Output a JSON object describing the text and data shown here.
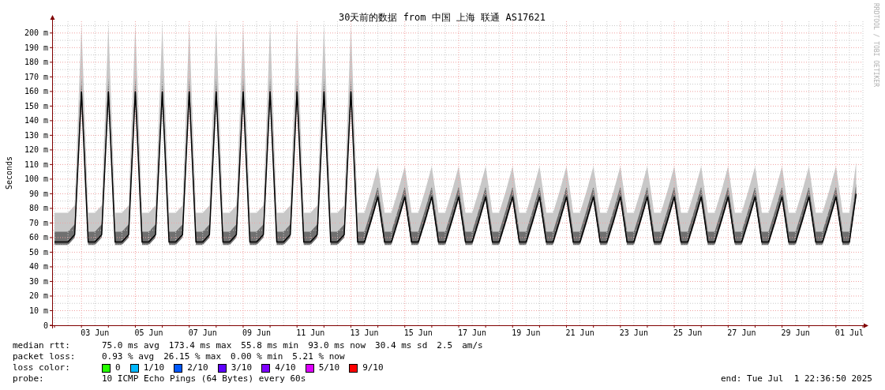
{
  "graph": {
    "credit": "RRDTOOL / TOBI OETIKER",
    "chart_data": {
      "type": "line",
      "title": "30天前的数据 from 中国 上海 联通 AS17621",
      "ylabel": "Seconds",
      "ylim": [
        0,
        208
      ],
      "grid": true,
      "yticks": [
        {
          "value": 0,
          "label": "0"
        },
        {
          "value": 10,
          "label": "10 m"
        },
        {
          "value": 20,
          "label": "20 m"
        },
        {
          "value": 30,
          "label": "30 m"
        },
        {
          "value": 40,
          "label": "40 m"
        },
        {
          "value": 50,
          "label": "50 m"
        },
        {
          "value": 60,
          "label": "60 m"
        },
        {
          "value": 70,
          "label": "70 m"
        },
        {
          "value": 80,
          "label": "80 m"
        },
        {
          "value": 90,
          "label": "90 m"
        },
        {
          "value": 100,
          "label": "100 m"
        },
        {
          "value": 110,
          "label": "110 m"
        },
        {
          "value": 120,
          "label": "120 m"
        },
        {
          "value": 130,
          "label": "130 m"
        },
        {
          "value": 140,
          "label": "140 m"
        },
        {
          "value": 150,
          "label": "150 m"
        },
        {
          "value": 160,
          "label": "160 m"
        },
        {
          "value": 170,
          "label": "170 m"
        },
        {
          "value": 180,
          "label": "180 m"
        },
        {
          "value": 190,
          "label": "190 m"
        },
        {
          "value": 200,
          "label": "200 m"
        }
      ],
      "categories": [
        null,
        null,
        null,
        null,
        null,
        null,
        "03 Jun",
        null,
        null,
        null,
        null,
        null,
        null,
        null,
        "05 Jun",
        null,
        null,
        null,
        null,
        null,
        null,
        null,
        "07 Jun",
        null,
        null,
        null,
        null,
        null,
        null,
        null,
        "09 Jun",
        null,
        null,
        null,
        null,
        null,
        null,
        null,
        "11 Jun",
        null,
        null,
        null,
        null,
        null,
        null,
        null,
        "13 Jun",
        null,
        null,
        null,
        null,
        null,
        null,
        null,
        "15 Jun",
        null,
        null,
        null,
        null,
        null,
        null,
        null,
        "17 Jun",
        null,
        null,
        null,
        null,
        null,
        null,
        null,
        "19 Jun",
        null,
        null,
        null,
        null,
        null,
        null,
        null,
        "21 Jun",
        null,
        null,
        null,
        null,
        null,
        null,
        null,
        "23 Jun",
        null,
        null,
        null,
        null,
        null,
        null,
        null,
        "25 Jun",
        null,
        null,
        null,
        null,
        null,
        null,
        null,
        "27 Jun",
        null,
        null,
        null,
        null,
        null,
        null,
        null,
        "29 Jun",
        null,
        null,
        null,
        null,
        null,
        null,
        null,
        "01 Jul",
        null
      ],
      "series": [
        {
          "color": "#000000",
          "values": [
            57,
            57,
            57,
            62,
            160,
            57,
            57,
            62,
            160,
            57,
            57,
            62,
            160,
            57,
            57,
            62,
            160,
            57,
            57,
            62,
            160,
            57,
            57,
            62,
            160,
            57,
            57,
            62,
            160,
            57,
            57,
            62,
            160,
            57,
            57,
            62,
            160,
            57,
            57,
            62,
            160,
            57,
            57,
            62,
            160,
            57,
            57,
            72,
            88,
            57,
            57,
            72,
            88,
            57,
            57,
            72,
            88,
            57,
            57,
            72,
            88,
            57,
            57,
            72,
            88,
            57,
            57,
            72,
            88,
            57,
            57,
            72,
            88,
            57,
            57,
            72,
            88,
            57,
            57,
            72,
            88,
            57,
            57,
            72,
            88,
            57,
            57,
            72,
            88,
            57,
            57,
            72,
            88,
            57,
            57,
            72,
            88,
            57,
            57,
            72,
            88,
            57,
            57,
            72,
            88,
            57,
            57,
            72,
            88,
            57,
            57,
            72,
            88,
            57,
            57,
            72,
            88,
            57,
            57,
            90
          ]
        }
      ]
    }
  },
  "legend": {
    "median_rtt": {
      "label": "median rtt:",
      "values": [
        "75.0 ms avg",
        "173.4 ms max",
        "55.8 ms min",
        "93.0 ms now",
        "30.4 ms sd",
        "2.5",
        "am/s"
      ]
    },
    "packet_loss": {
      "label": "packet loss:",
      "values": [
        "0.93 % avg",
        "26.15 % max",
        "0.00 % min",
        "5.21 % now"
      ]
    },
    "loss_color": {
      "label": "loss color:",
      "items": [
        {
          "label": "0",
          "color": "#26ff00"
        },
        {
          "label": "1/10",
          "color": "#00b8ff"
        },
        {
          "label": "2/10",
          "color": "#0059ff"
        },
        {
          "label": "3/10",
          "color": "#5e00ff"
        },
        {
          "label": "4/10",
          "color": "#7e00ff"
        },
        {
          "label": "5/10",
          "color": "#dd00ff"
        },
        {
          "label": "9/10",
          "color": "#ff0000"
        }
      ]
    },
    "probe": {
      "label": "probe:",
      "value": "10 ICMP Echo Pings (64 Bytes) every 60s"
    },
    "end": "end: Tue Jul  1 22:36:50 2025"
  }
}
